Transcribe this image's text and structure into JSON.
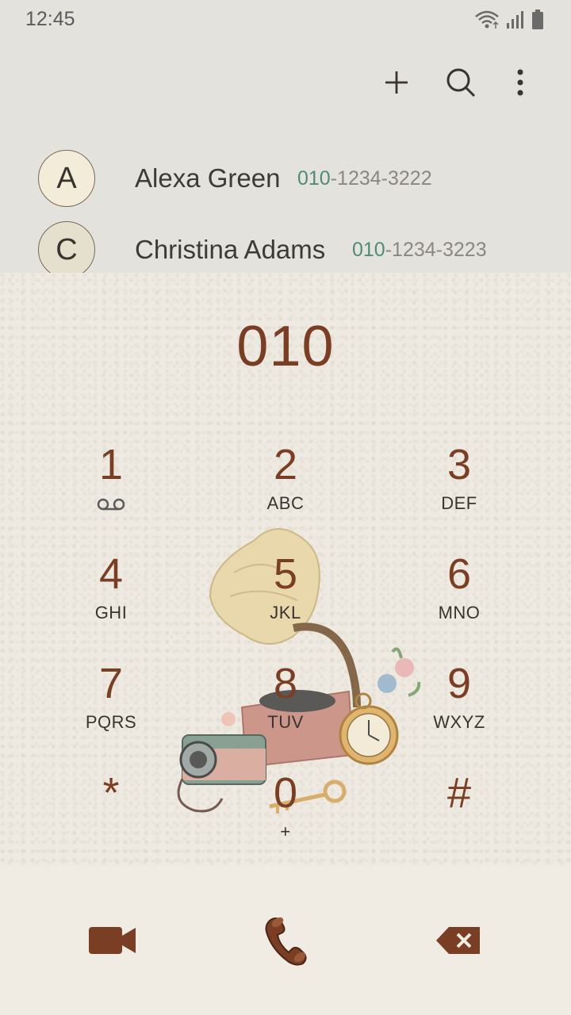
{
  "status": {
    "time": "12:45",
    "icons": [
      "wifi-icon",
      "signal-icon",
      "battery-icon"
    ]
  },
  "toolbar": {
    "actions": [
      "add-icon",
      "search-icon",
      "more-icon"
    ]
  },
  "contacts": [
    {
      "initial": "A",
      "name": "Alexa Green",
      "number_match": "010",
      "number_rest": "-1234-3222"
    },
    {
      "initial": "C",
      "name": "Christina Adams",
      "number_match": "010",
      "number_rest": "-1234-3223"
    }
  ],
  "dialer": {
    "input": "010",
    "keys": [
      {
        "digit": "1",
        "letters": ""
      },
      {
        "digit": "2",
        "letters": "ABC"
      },
      {
        "digit": "3",
        "letters": "DEF"
      },
      {
        "digit": "4",
        "letters": "GHI"
      },
      {
        "digit": "5",
        "letters": "JKL"
      },
      {
        "digit": "6",
        "letters": "MNO"
      },
      {
        "digit": "7",
        "letters": "PQRS"
      },
      {
        "digit": "8",
        "letters": "TUV"
      },
      {
        "digit": "9",
        "letters": "WXYZ"
      },
      {
        "digit": "*",
        "letters": ""
      },
      {
        "digit": "0",
        "letters": "+"
      },
      {
        "digit": "#",
        "letters": ""
      }
    ]
  },
  "bottom": {
    "actions": [
      "video-call-icon",
      "phone-call-icon",
      "backspace-icon"
    ]
  },
  "colors": {
    "accent": "#7a3e24",
    "match": "#4e8c7a",
    "background": "#e3e2dd"
  }
}
